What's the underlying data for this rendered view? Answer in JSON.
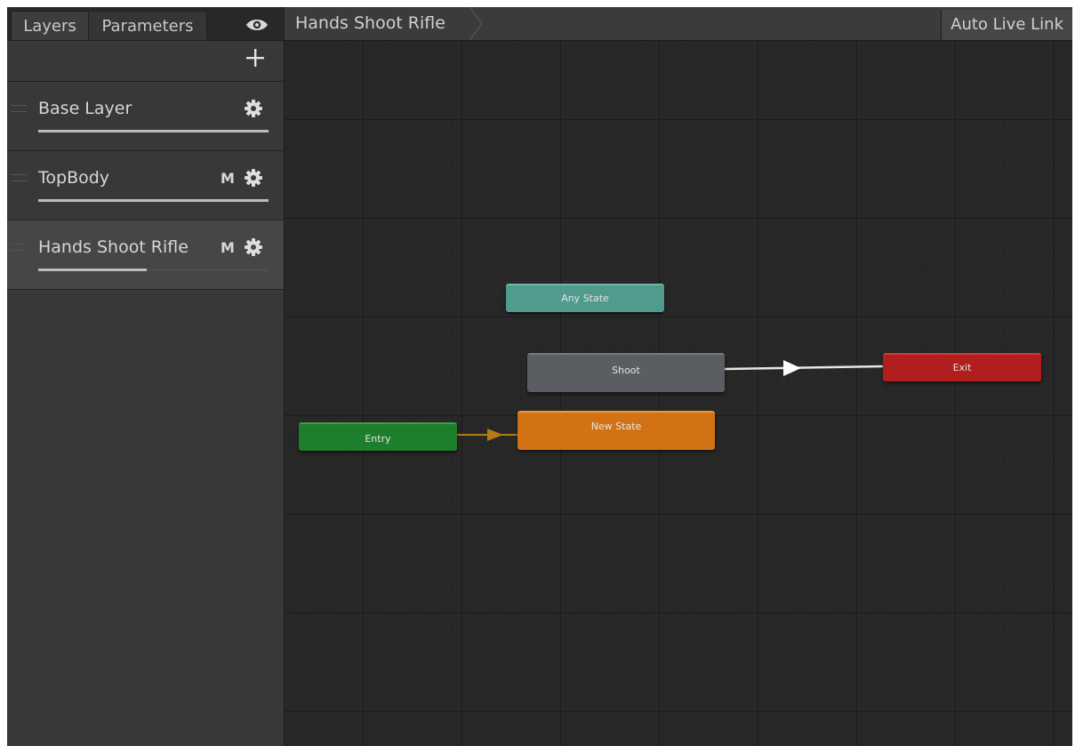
{
  "left_panel": {
    "tabs": [
      {
        "label": "Layers"
      },
      {
        "label": "Parameters"
      }
    ],
    "eye_icon": "eye-icon",
    "add_icon": "plus-icon",
    "layers": [
      {
        "label": "Base Layer",
        "mask": "",
        "weight": 1.0,
        "selected": false
      },
      {
        "label": "TopBody",
        "mask": "M",
        "weight": 1.0,
        "selected": false
      },
      {
        "label": "Hands Shoot Rifle",
        "mask": "M",
        "weight": 0.47,
        "selected": true
      }
    ]
  },
  "graph": {
    "breadcrumb": "Hands Shoot Rifle",
    "live_link": "Auto Live Link",
    "nodes": {
      "any_state": "Any State",
      "shoot": "Shoot",
      "exit": "Exit",
      "entry": "Entry",
      "new_state": "New State"
    },
    "colors": {
      "any_state": "#4f9b8d",
      "shoot": "#5a5e63",
      "exit": "#b21d1d",
      "entry": "#1d7e2c",
      "new_state": "#d27215",
      "default_transition": "#b47a14",
      "transition": "#e6e6e6"
    }
  }
}
